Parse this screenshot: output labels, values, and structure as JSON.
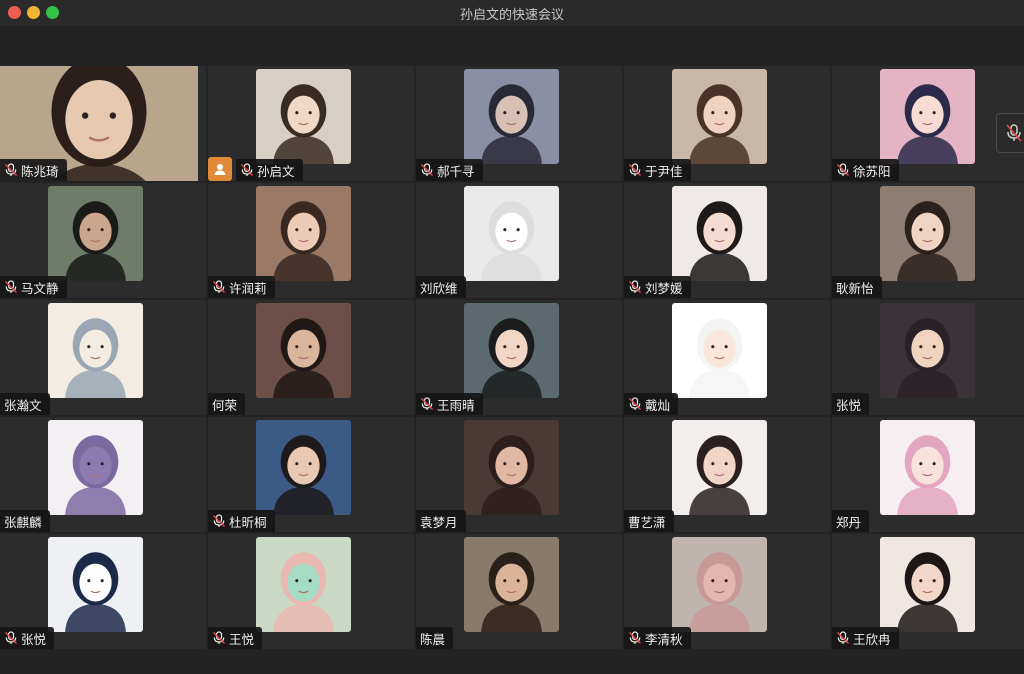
{
  "window": {
    "title": "孙启文的快速会议"
  },
  "participants": [
    {
      "name": "陈兆琦",
      "muted": true,
      "self": true,
      "bg": "#b9a58c",
      "skin": "#e6c9b0",
      "hair": "#2a1f1a"
    },
    {
      "name": "孙启文",
      "muted": true,
      "host": true,
      "bg": "#d8cfc4",
      "skin": "#f1d8c6",
      "hair": "#3a2b22"
    },
    {
      "name": "郝千寻",
      "muted": true,
      "bg": "#8a8fa6",
      "skin": "#d8c0b4",
      "hair": "#2a2a36"
    },
    {
      "name": "于尹佳",
      "muted": true,
      "bg": "#c9b8a8",
      "skin": "#efd2c0",
      "hair": "#4a3226"
    },
    {
      "name": "徐苏阳",
      "muted": true,
      "bg": "#e4b3c4",
      "skin": "#f6dcd2",
      "hair": "#2b2a4a"
    },
    {
      "name": "马文静",
      "muted": true,
      "bg": "#6f7c6a",
      "skin": "#c9a78e",
      "hair": "#1a1a1a"
    },
    {
      "name": "许润莉",
      "muted": true,
      "bg": "#9a7a66",
      "skin": "#ecccb6",
      "hair": "#3a2820"
    },
    {
      "name": "刘欣维",
      "muted": false,
      "bg": "#e9e9ea",
      "skin": "#ffffff",
      "hair": "#dddddd"
    },
    {
      "name": "刘梦媛",
      "muted": true,
      "bg": "#efeae8",
      "skin": "#f4dcd0",
      "hair": "#1e1a1a"
    },
    {
      "name": "耿新怡",
      "muted": false,
      "bg": "#8e7e72",
      "skin": "#efd4c4",
      "hair": "#2a201c"
    },
    {
      "name": "张瀚文",
      "muted": false,
      "bg": "#f3ece2",
      "skin": "#f3ece2",
      "hair": "#9aa6b3"
    },
    {
      "name": "何荣",
      "muted": false,
      "bg": "#6c5048",
      "skin": "#d9b59e",
      "hair": "#201816"
    },
    {
      "name": "王雨晴",
      "muted": true,
      "bg": "#5a6a6e",
      "skin": "#f1d6c6",
      "hair": "#1c1c1c"
    },
    {
      "name": "戴灿",
      "muted": true,
      "bg": "#ffffff",
      "skin": "#fbe6dc",
      "hair": "#f4f4f4"
    },
    {
      "name": "张悦",
      "muted": false,
      "bg": "#3a3438",
      "skin": "#f0d4c0",
      "hair": "#2a2226"
    },
    {
      "name": "张麒麟",
      "muted": false,
      "bg": "#f3f0f3",
      "skin": "#8c7bb0",
      "hair": "#7b6aa0"
    },
    {
      "name": "杜昕桐",
      "muted": true,
      "bg": "#3b5a86",
      "skin": "#e9c9b4",
      "hair": "#1e1a1a"
    },
    {
      "name": "袁梦月",
      "muted": false,
      "bg": "#4a3a36",
      "skin": "#e0b8a4",
      "hair": "#2a1f1c"
    },
    {
      "name": "曹艺潇",
      "muted": false,
      "bg": "#f2eeee",
      "skin": "#f1d6c8",
      "hair": "#2a2020"
    },
    {
      "name": "郑丹",
      "muted": false,
      "bg": "#f6eef0",
      "skin": "#f9e2da",
      "hair": "#e3a6c0"
    },
    {
      "name": "张悦",
      "muted": true,
      "bg": "#eef0f4",
      "skin": "#ffffff",
      "hair": "#1c2a4a"
    },
    {
      "name": "王悦",
      "muted": true,
      "bg": "#c9d9c3",
      "skin": "#a4dcc6",
      "hair": "#e9b8b0"
    },
    {
      "name": "陈晨",
      "muted": false,
      "bg": "#8a7a6a",
      "skin": "#d9b49a",
      "hair": "#2a201a"
    },
    {
      "name": "李清秋",
      "muted": true,
      "bg": "#bfb4ae",
      "skin": "#e3b6ae",
      "hair": "#c89a96"
    },
    {
      "name": "王欣冉",
      "muted": true,
      "bg": "#efe6e2",
      "skin": "#f2d7c8",
      "hair": "#1c1616"
    }
  ]
}
